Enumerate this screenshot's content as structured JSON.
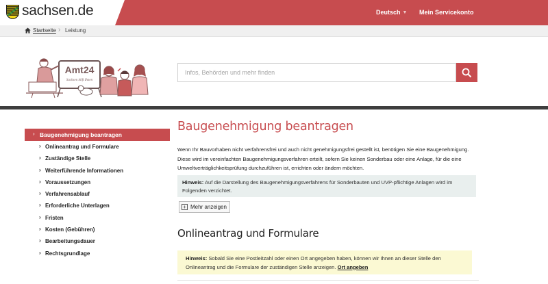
{
  "header": {
    "site_name": "sachsen.de",
    "language": "Deutsch",
    "account": "Mein Servicekonto"
  },
  "breadcrumb": {
    "home": "Startseite",
    "current": "Leistung"
  },
  "illustration": {
    "sign_text": "Amt24",
    "sign_subtext": "Sachsen hilft Ihnen"
  },
  "search": {
    "placeholder": "Infos, Behörden und mehr finden"
  },
  "sidebar": {
    "active": "Baugenehmigung beantragen",
    "items": [
      "Onlineantrag und Formulare",
      "Zuständige Stelle",
      "Weiterführende Informationen",
      "Voraussetzungen",
      "Verfahrensablauf",
      "Erforderliche Unterlagen",
      "Fristen",
      "Kosten (Gebühren)",
      "Bearbeitungsdauer",
      "Rechtsgrundlage"
    ]
  },
  "main": {
    "title": "Baugenehmigung beantragen",
    "intro": "Wenn Ihr Bauvorhaben nicht verfahrensfrei und auch nicht genehmigungsfrei gestellt ist, benötigen Sie eine Baugenehmigung. Diese wird im vereinfachten Baugenehmigungsverfahren erteilt, sofern Sie keinen Sonderbau oder eine Anlage, für die eine Umweltverträglichkeitsprüfung durchzuführen ist, errichten oder ändern möchten.",
    "note_label": "Hinweis:",
    "note_text": "Auf die Darstellung des Baugenehmigungsverfahrens für Sonderbauten und UVP-pflichtige Anlagen wird im Folgenden verzichtet.",
    "more_button": "Mehr anzeigen",
    "section_title": "Onlineantrag und Formulare",
    "hint_label": "Hinweis:",
    "hint_text": "Sobald Sie eine Postleitzahl oder einen Ort angegeben haben, können wir Ihnen an dieser Stelle den Onlineantrag und die Formulare der zuständigen Stelle anzeigen.",
    "hint_link": "Ort angeben"
  },
  "colors": {
    "accent": "#c74c4f",
    "dark_bar": "#3e3e3e",
    "note_grey": "#e9efee",
    "note_yellow": "#fbf9d3"
  }
}
